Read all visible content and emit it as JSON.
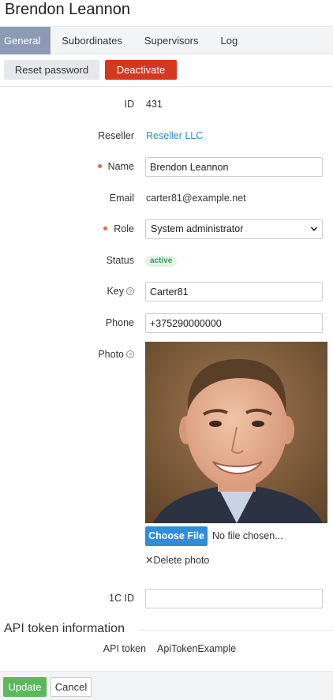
{
  "header": {
    "title": "Brendon Leannon"
  },
  "tabs": [
    {
      "label": "General"
    },
    {
      "label": "Subordinates"
    },
    {
      "label": "Supervisors"
    },
    {
      "label": "Log"
    }
  ],
  "actions": {
    "reset_password": "Reset password",
    "deactivate": "Deactivate"
  },
  "form": {
    "id": {
      "label": "ID",
      "value": "431"
    },
    "reseller": {
      "label": "Reseller",
      "value": "Reseller LLC"
    },
    "name": {
      "label": "Name",
      "value": "Brendon Leannon"
    },
    "email": {
      "label": "Email",
      "value": "carter81@example.net"
    },
    "role": {
      "label": "Role",
      "value": "System administrator"
    },
    "status": {
      "label": "Status",
      "value": "active"
    },
    "key": {
      "label": "Key",
      "value": "Carter81"
    },
    "phone": {
      "label": "Phone",
      "value": "+375290000000"
    },
    "photo": {
      "label": "Photo",
      "choose_file": "Choose File",
      "no_file": "No file chosen...",
      "delete": "Delete photo"
    },
    "one_c_id": {
      "label": "1C ID",
      "value": ""
    }
  },
  "api_token": {
    "section_title": "API token information",
    "label": "API token",
    "value": "ApiTokenExample"
  },
  "footer": {
    "update": "Update",
    "cancel": "Cancel"
  },
  "icons": {
    "help": "question-circle-icon",
    "required": "required-dot-icon",
    "select": "chevron-down-icon",
    "delete": "close-icon"
  },
  "colors": {
    "tab_active": "#8c9bb3",
    "deactivate": "#d5381f",
    "link": "#2f8ddb",
    "update": "#5cb85c",
    "required": "#e8694a",
    "status_bg": "#e3f3e7",
    "status_text": "#3f9a59"
  }
}
